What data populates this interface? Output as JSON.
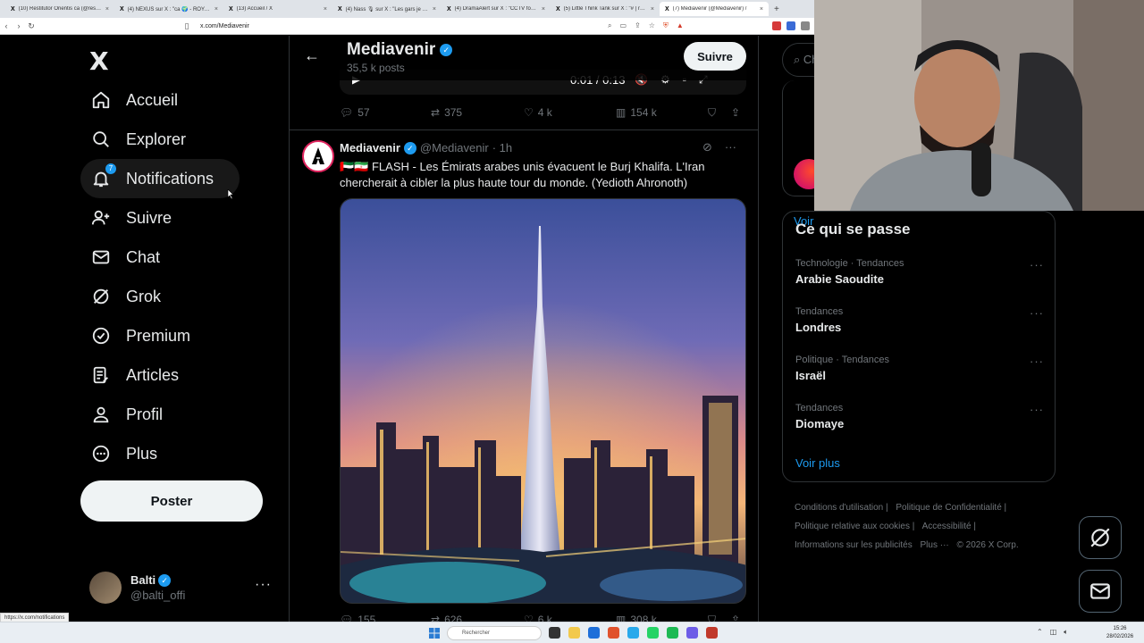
{
  "browser": {
    "tabs": [
      {
        "label": "(10) Restitutor Orientis ca (@restitut",
        "active": false
      },
      {
        "label": "(4) NEXUS sur X : \"ca 🌍 - ROYAUME",
        "active": false
      },
      {
        "label": "(13) Accueil / X",
        "active": false
      },
      {
        "label": "(4) Nass 🎙 sur X : \"Les gars je suis",
        "active": false
      },
      {
        "label": "(4) DramaAlert sur X : \"CCTV footage",
        "active": false
      },
      {
        "label": "(5) Little Think Tank sur X : \"# | ra FR",
        "active": false
      },
      {
        "label": "(7) Mediavenir (@Mediavenir) /",
        "active": true
      }
    ],
    "tab_favicon": "X",
    "new_tab": "+",
    "url": "x.com/Mediavenir",
    "status_url": "https://x.com/notifications"
  },
  "nav": {
    "logo": "X",
    "items": [
      {
        "label": "Accueil",
        "icon": "home-icon"
      },
      {
        "label": "Explorer",
        "icon": "search-icon"
      },
      {
        "label": "Notifications",
        "icon": "bell-icon",
        "badge": "7"
      },
      {
        "label": "Suivre",
        "icon": "add-person-icon"
      },
      {
        "label": "Chat",
        "icon": "mail-icon"
      },
      {
        "label": "Grok",
        "icon": "grok-icon"
      },
      {
        "label": "Premium",
        "icon": "verified-icon"
      },
      {
        "label": "Articles",
        "icon": "article-icon"
      },
      {
        "label": "Profil",
        "icon": "person-icon"
      },
      {
        "label": "Plus",
        "icon": "more-circle-icon"
      }
    ],
    "post_button": "Poster",
    "account": {
      "name": "Balti",
      "handle": "@balti_offi"
    }
  },
  "profile_header": {
    "name": "Mediavenir",
    "post_count": "35,5 k posts",
    "follow_button": "Suivre"
  },
  "prev_tweet": {
    "video_time": "0:01 / 0:13",
    "replies": "57",
    "retweets": "375",
    "likes": "4 k",
    "views": "154 k"
  },
  "tweet": {
    "name": "Mediavenir",
    "handle": "@Mediavenir",
    "time": "· 1h",
    "text": "🇦🇪🇮🇷 FLASH - Les Émirats arabes unis évacuent le Burj Khalifa. L'Iran chercherait à cibler la plus haute tour du monde. (Yedioth Ahronoth)",
    "replies": "155",
    "retweets": "626",
    "likes": "6 k",
    "views": "308 k"
  },
  "sidebar": {
    "search_placeholder": "Ch",
    "voir_label": "Voir",
    "trends_title": "Ce qui se passe",
    "trends": [
      {
        "category": "Technologie · Tendances",
        "name": "Arabie Saoudite"
      },
      {
        "category": "Tendances",
        "name": "Londres"
      },
      {
        "category": "Politique · Tendances",
        "name": "Israël"
      },
      {
        "category": "Tendances",
        "name": "Diomaye"
      }
    ],
    "voir_plus": "Voir plus",
    "footer": [
      "Conditions d'utilisation |",
      "Politique de Confidentialité |",
      "Politique relative aux cookies |",
      "Accessibilité |",
      "Informations sur les publicités",
      "Plus ···",
      "© 2026 X Corp."
    ]
  },
  "taskbar": {
    "search_label": "Rechercher",
    "time": "15:26",
    "date": "28/02/2026"
  },
  "colors": {
    "accent": "#1d9bf0",
    "background": "#000000",
    "border": "#2f3336",
    "muted": "#71767b"
  }
}
